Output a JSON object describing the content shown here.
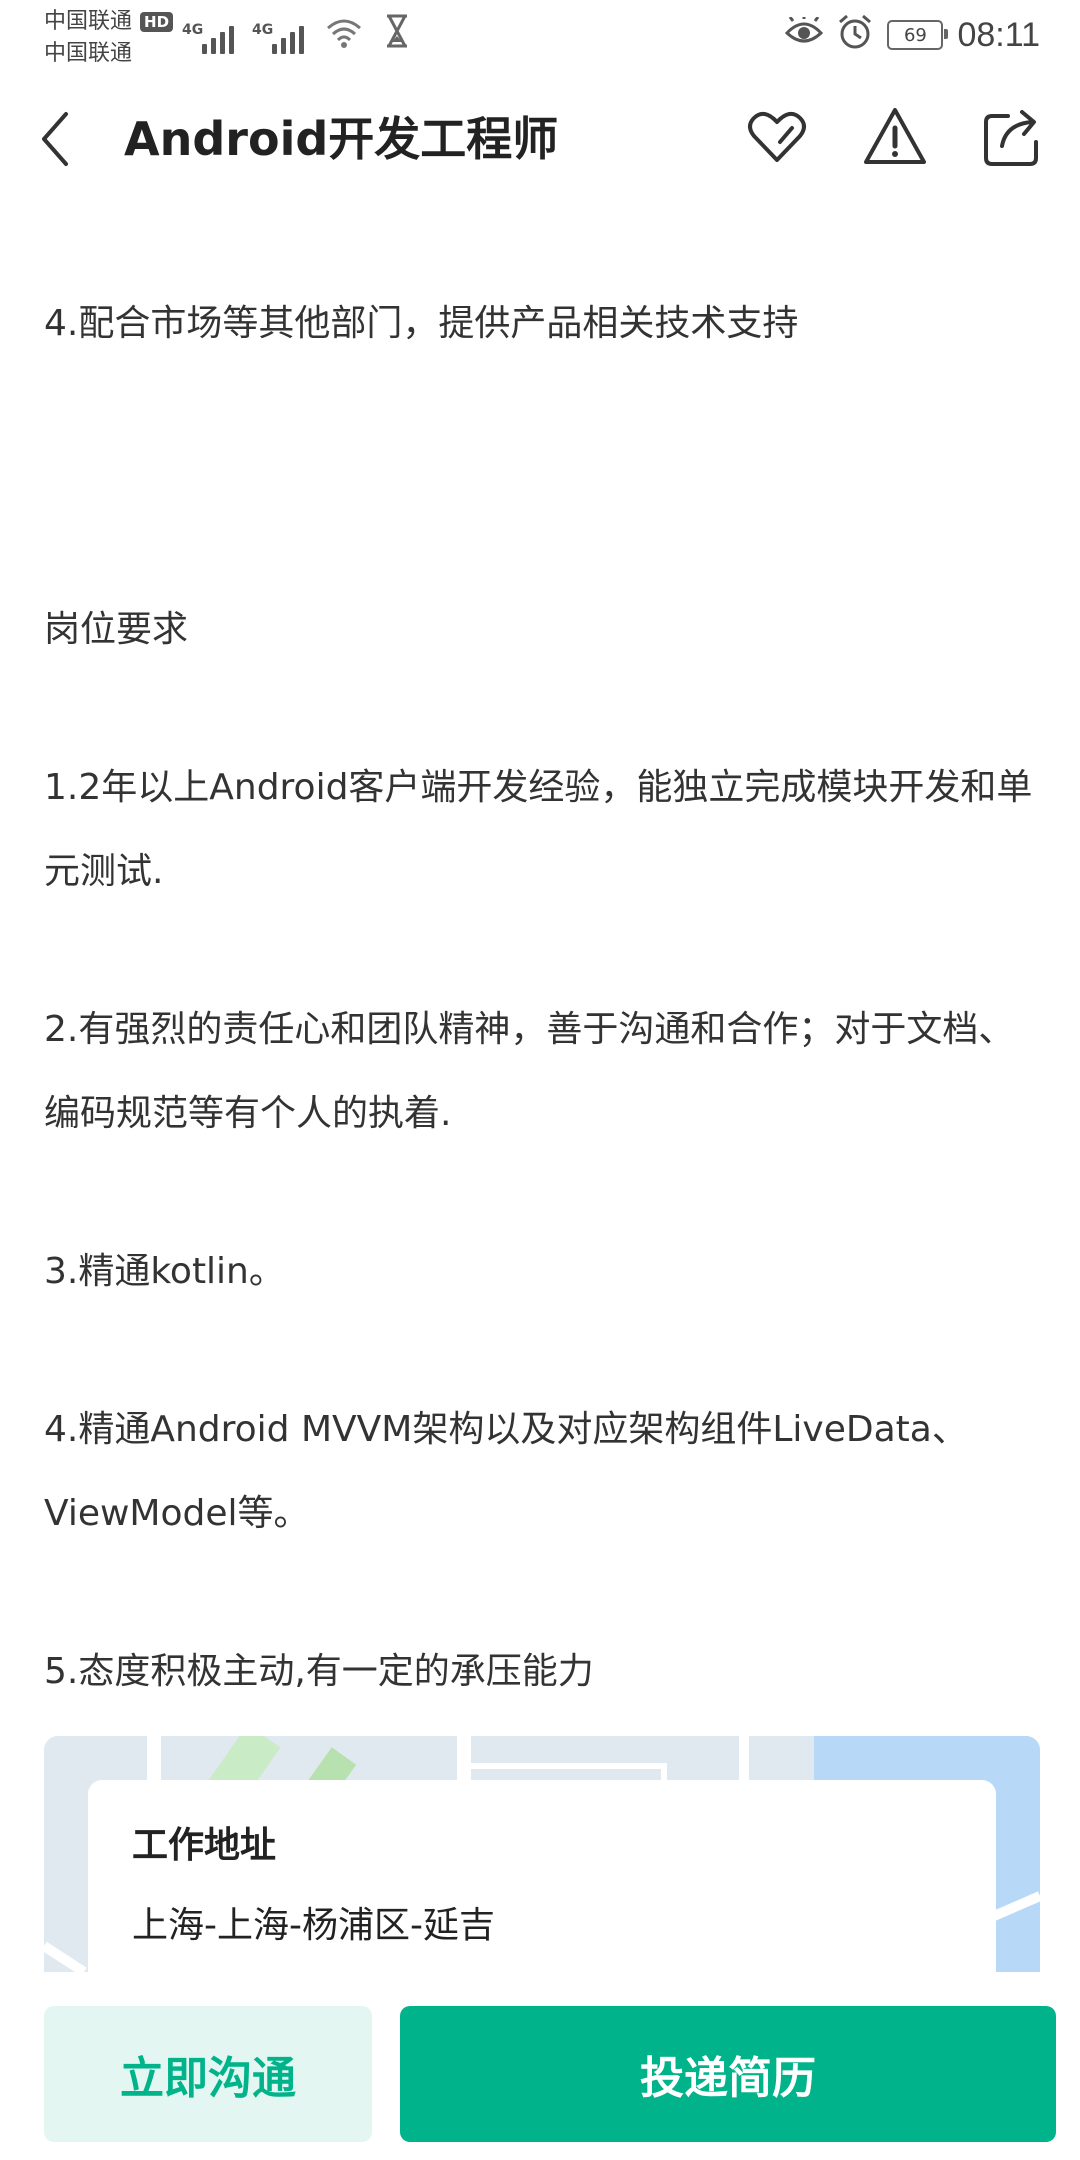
{
  "status_bar": {
    "carrier1": "中国联通",
    "carrier2": "中国联通",
    "hd_badge": "HD",
    "network1": "4G",
    "network2": "4G",
    "battery_level": "69",
    "time": "08:11",
    "icons": [
      "signal-icon",
      "wifi-icon",
      "hourglass-icon",
      "eye-icon",
      "alarm-icon",
      "battery-icon"
    ]
  },
  "header": {
    "title": "Android开发工程师",
    "icons": [
      "back-arrow-icon",
      "heart-icon",
      "warning-icon",
      "share-icon"
    ]
  },
  "content": {
    "duty4": "4.配合市场等其他部门，提供产品相关技术支持",
    "requirements_heading": "岗位要求",
    "req1": "1.2年以上Android客户端开发经验，能独立完成模块开发和单元测试.",
    "req2": "2.有强烈的责任心和团队精神，善于沟通和合作；对于文档、编码规范等有个人的执着.",
    "req3": "3.精通kotlin。",
    "req4": "4.精通Android MVVM架构以及对应架构组件LiveData、ViewModel等。",
    "req5": "5.态度积极主动,有一定的承压能力"
  },
  "address": {
    "title": "工作地址",
    "value": "上海-上海-杨浦区-延吉"
  },
  "actions": {
    "chat_label": "立即沟通",
    "apply_label": "投递简历"
  },
  "colors": {
    "accent": "#00b38a",
    "accent_light": "#e3f6f1",
    "text": "#333333"
  }
}
